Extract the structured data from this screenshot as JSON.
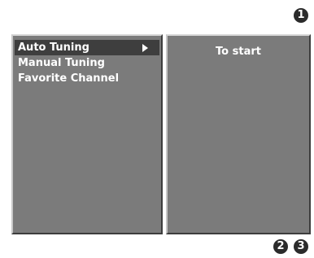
{
  "badges": {
    "top": "1",
    "bottom_left": "2",
    "bottom_right": "3"
  },
  "menu": {
    "items": [
      {
        "label": "Auto Tuning",
        "selected": true
      },
      {
        "label": "Manual Tuning",
        "selected": false
      },
      {
        "label": "Favorite Channel",
        "selected": false
      }
    ]
  },
  "info": {
    "hint": "To start"
  },
  "colors": {
    "panel_bg": "#7b7b7b",
    "selected_bg": "#3e3e3e",
    "text": "#ffffff",
    "badge_bg": "#2b2b2b"
  }
}
